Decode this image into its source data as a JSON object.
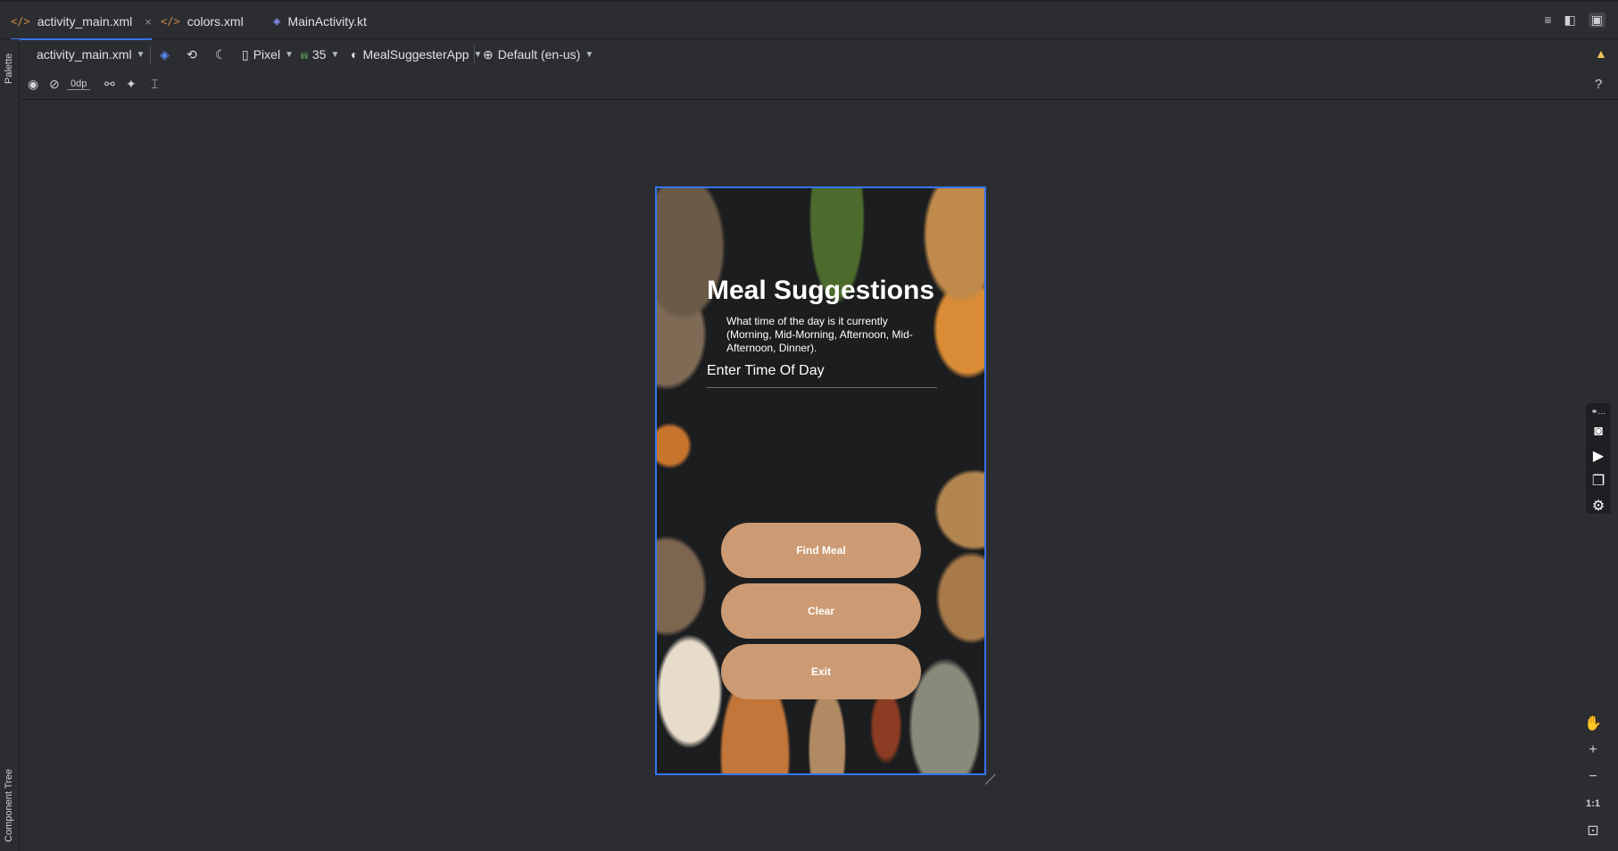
{
  "tabs": [
    {
      "icon": "</>",
      "label": "activity_main.xml",
      "active": true,
      "close": "×"
    },
    {
      "icon": "</>",
      "label": "colors.xml",
      "active": false
    },
    {
      "icon": "kotlin-file-icon",
      "label": "MainActivity.kt",
      "active": false
    }
  ],
  "side_panels": {
    "palette": "Palette",
    "component_tree": "Component Tree"
  },
  "toolbar": {
    "file": "activity_main.xml",
    "device": "Pixel",
    "api": "35",
    "theme": "MealSuggesterApp",
    "locale": "Default (en-us)",
    "margin": "0dp"
  },
  "phone": {
    "title": "Meal Suggestions",
    "description": "What time of the day is it currently (Morning, Mid-Morning, Afternoon, Mid-Afternoon, Dinner).",
    "input_hint": "Enter Time Of Day",
    "buttons": [
      "Find Meal",
      "Clear",
      "Exit"
    ],
    "button_color": "#cc9b73"
  },
  "zoom": {
    "reset_label": "1:1"
  },
  "colors": {
    "accent": "#3574f0",
    "warning": "#f2c55c"
  }
}
